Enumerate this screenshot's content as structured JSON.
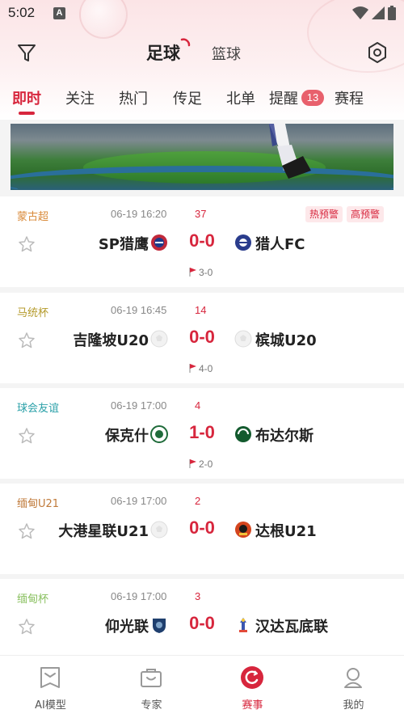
{
  "status_bar": {
    "time": "5:02",
    "notif_letter": "A"
  },
  "header": {
    "sport_active": "足球",
    "sport_other": "篮球"
  },
  "subtabs": [
    {
      "label": "即时",
      "active": true
    },
    {
      "label": "关注"
    },
    {
      "label": "热门"
    },
    {
      "label": "传足"
    },
    {
      "label": "北单"
    },
    {
      "label": "提醒"
    },
    {
      "label": "赛程"
    }
  ],
  "reminder_badge": "13",
  "matches": [
    {
      "league": "蒙古超",
      "league_color": "#d98a3a",
      "time": "06-19 16:20",
      "minute": "37",
      "tags": [
        "热预警",
        "高预警"
      ],
      "home": "SP猎鹰",
      "away": "猎人FC",
      "score": "0-0",
      "corners": "3-0"
    },
    {
      "league": "马统杯",
      "league_color": "#b49a2a",
      "time": "06-19 16:45",
      "minute": "14",
      "tags": [],
      "home": "吉隆坡U20",
      "away": "槟城U20",
      "score": "0-0",
      "corners": "4-0"
    },
    {
      "league": "球会友谊",
      "league_color": "#2aa0a8",
      "time": "06-19 17:00",
      "minute": "4",
      "tags": [],
      "home": "保克什",
      "away": "布达尔斯",
      "score": "1-0",
      "corners": "2-0"
    },
    {
      "league": "缅甸U21",
      "league_color": "#c07a3a",
      "time": "06-19 17:00",
      "minute": "2",
      "tags": [],
      "home": "大港星联U21",
      "away": "达根U21",
      "score": "0-0",
      "corners": ""
    },
    {
      "league": "缅甸杯",
      "league_color": "#8ac060",
      "time": "06-19 17:00",
      "minute": "3",
      "tags": [],
      "home": "仰光联",
      "away": "汉达瓦底联",
      "score": "0-0",
      "corners": ""
    }
  ],
  "tabbar": [
    {
      "label": "AI模型",
      "icon": "ai-model-icon"
    },
    {
      "label": "专家",
      "icon": "expert-icon"
    },
    {
      "label": "赛事",
      "icon": "match-icon",
      "active": true
    },
    {
      "label": "我的",
      "icon": "profile-icon"
    }
  ],
  "colors": {
    "accent": "#d7263d",
    "tag_bg": "#fde8ea"
  }
}
